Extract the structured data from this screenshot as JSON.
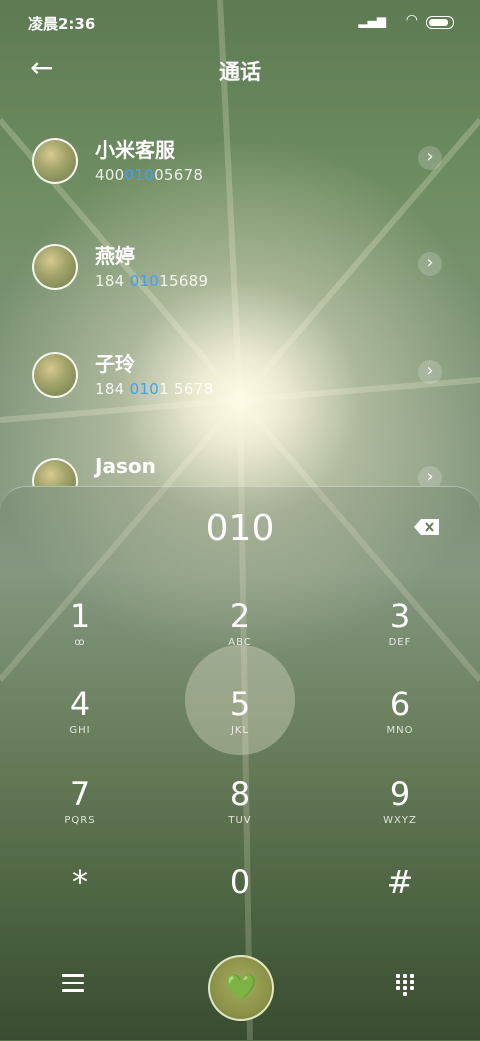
{
  "status_bar": {
    "time": "凌晨2:36",
    "signal_icon": "signal-icon",
    "wifi_icon": "wifi-icon",
    "battery_icon": "battery-icon"
  },
  "app_bar": {
    "title": "通话",
    "back_icon": "arrow-left-icon"
  },
  "contacts": [
    {
      "name": "小米客服",
      "number_pre": "400",
      "number_hl": "010",
      "number_post": "05678"
    },
    {
      "name": "燕婷",
      "number_pre": "184 ",
      "number_hl": "010",
      "number_post": "15689"
    },
    {
      "name": "子玲",
      "number_pre": "184 ",
      "number_hl": "010",
      "number_post": "1 5678"
    },
    {
      "name": "Jason",
      "number_pre": "",
      "number_hl": "",
      "number_post": ""
    }
  ],
  "dialpad": {
    "entered": "010",
    "keys": [
      {
        "digit": "1",
        "letters": "ꝏ"
      },
      {
        "digit": "2",
        "letters": "ABC"
      },
      {
        "digit": "3",
        "letters": "DEF"
      },
      {
        "digit": "4",
        "letters": "GHI"
      },
      {
        "digit": "5",
        "letters": "JKL"
      },
      {
        "digit": "6",
        "letters": "MNO"
      },
      {
        "digit": "7",
        "letters": "PQRS"
      },
      {
        "digit": "8",
        "letters": "TUV"
      },
      {
        "digit": "9",
        "letters": "WXYZ"
      },
      {
        "digit": "*",
        "letters": ""
      },
      {
        "digit": "0",
        "letters": ""
      },
      {
        "digit": "#",
        "letters": ""
      }
    ]
  },
  "bottom_bar": {
    "call_glyph": "💚",
    "menu_icon": "menu-icon",
    "keypad_icon": "keypad-icon"
  }
}
